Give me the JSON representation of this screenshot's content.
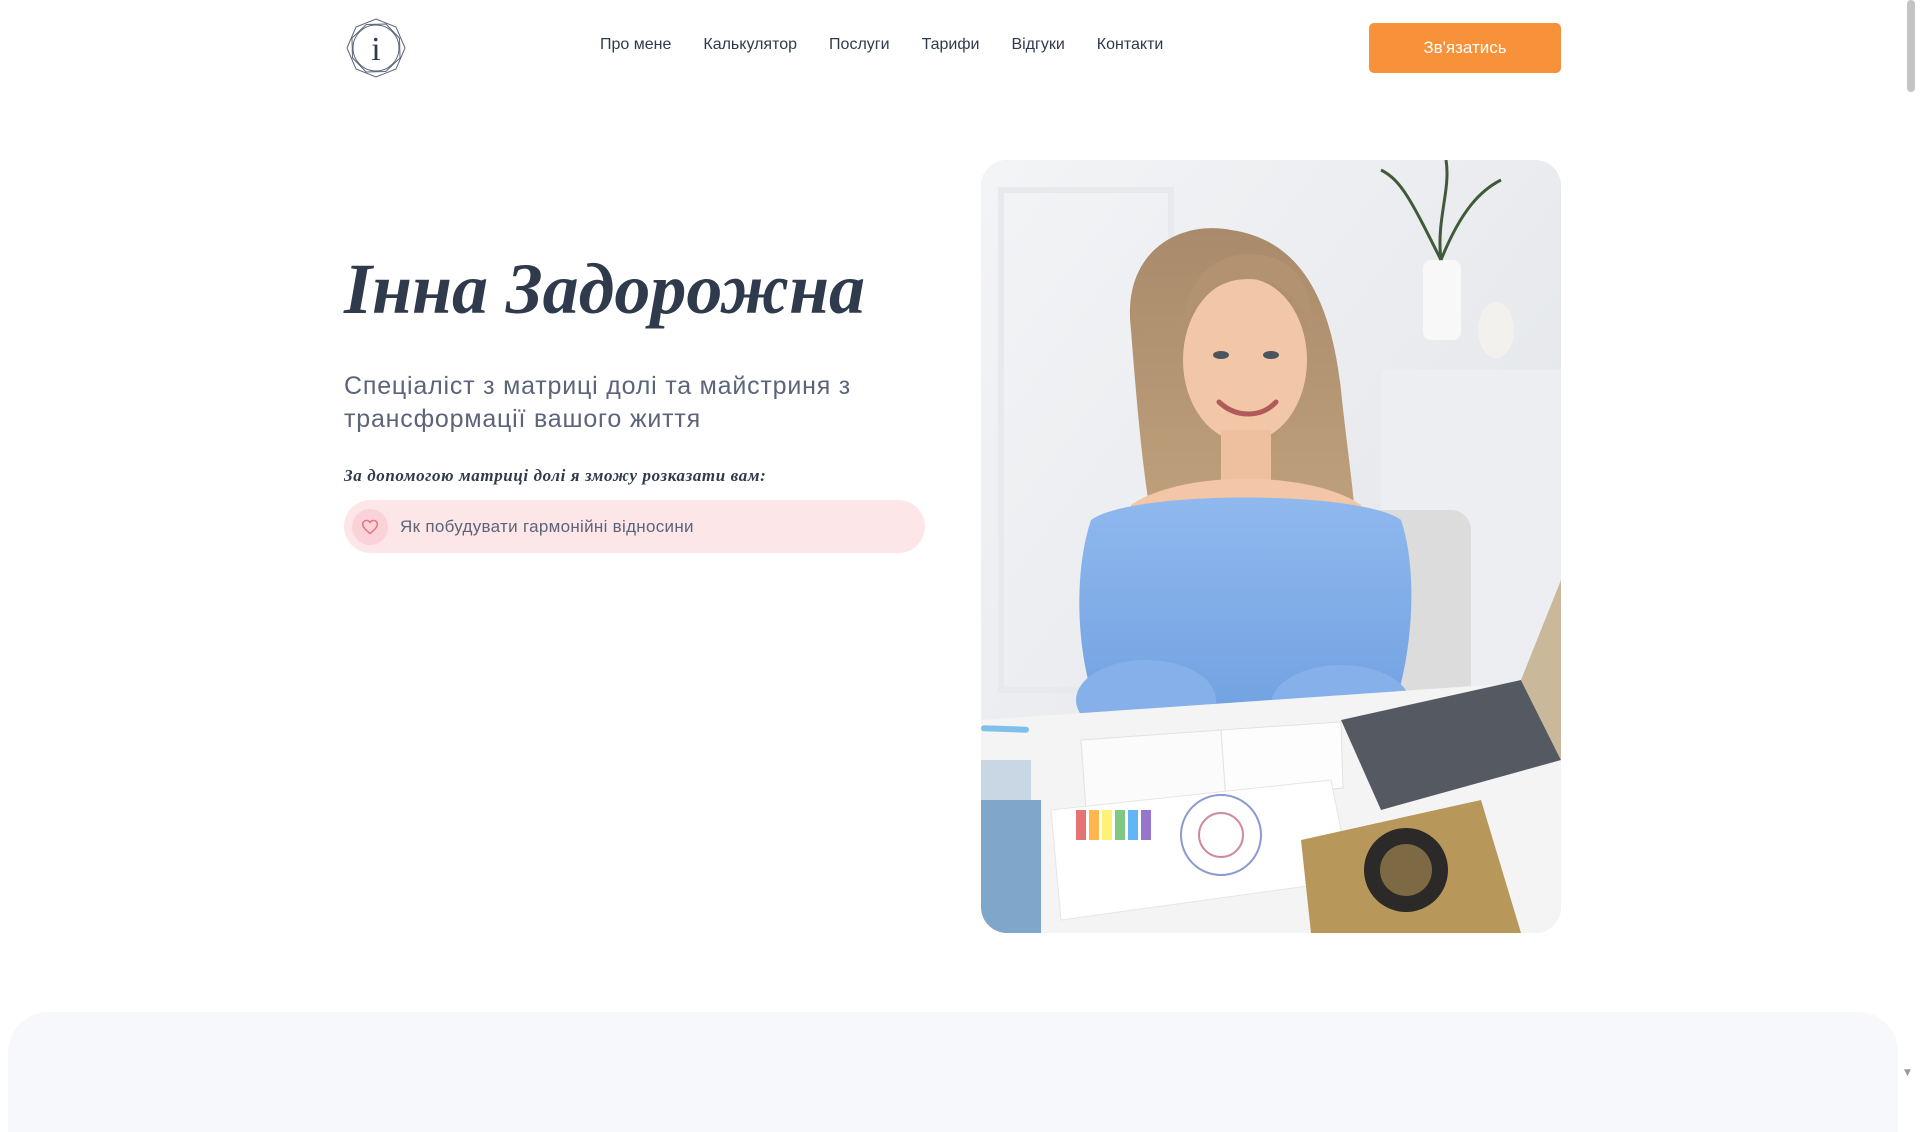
{
  "header": {
    "logo_letter": "i",
    "nav": [
      "Про мене",
      "Калькулятор",
      "Послуги",
      "Тарифи",
      "Відгуки",
      "Контакти"
    ],
    "cta_label": "Зв'язатись"
  },
  "hero": {
    "title": "Інна Задорожна",
    "subtitle": "Спеціаліст з матриці долі та майстриня з трансформації вашого життя",
    "lead": "За допомогою матриці долі я зможу розказати вам:",
    "topic": "Як побудувати гармонійні відносини",
    "topic_icon": "heart-icon"
  },
  "photo": {
    "icon": "portrait-photo"
  },
  "colors": {
    "accent": "#f7923a",
    "text_dark": "#2f3a4c",
    "text_muted": "#5b6478",
    "pill_bg": "#fde6e8",
    "heart": "#e8717f"
  }
}
